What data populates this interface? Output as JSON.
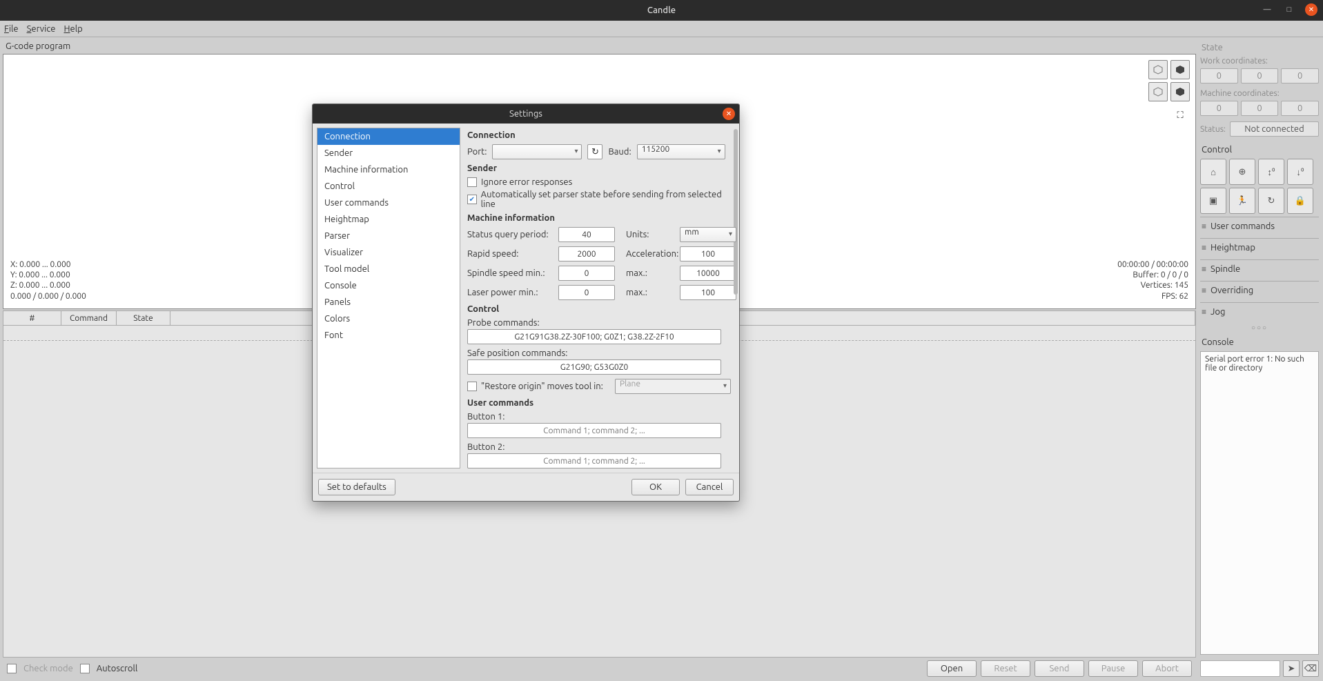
{
  "os": {
    "title": "Candle",
    "minimize": "—",
    "maximize": "□",
    "close": "✕"
  },
  "menu": {
    "file": "File",
    "service": "Service",
    "help": "Help"
  },
  "main": {
    "gcode_label": "G-code program",
    "viz": {
      "left_overlay": "X: 0.000 ... 0.000\nY: 0.000 ... 0.000\nZ: 0.000 ... 0.000\n0.000 / 0.000 / 0.000",
      "right_overlay": "00:00:00 / 00:00:00\nBuffer: 0 / 0 / 0\nVertices: 145\nFPS: 62"
    },
    "table": {
      "col_idx": "#",
      "col_cmd": "Command",
      "col_state": "State",
      "col_resp": ""
    },
    "bottom": {
      "check_mode": "Check mode",
      "autoscroll": "Autoscroll",
      "open": "Open",
      "reset": "Reset",
      "send": "Send",
      "pause": "Pause",
      "abort": "Abort"
    }
  },
  "side": {
    "state": "State",
    "work_coords": "Work coordinates:",
    "machine_coords": "Machine coordinates:",
    "zero": "0",
    "status_label": "Status:",
    "status_value": "Not connected",
    "control": "Control",
    "acc_user": "User commands",
    "acc_height": "Heightmap",
    "acc_spindle": "Spindle",
    "acc_over": "Overriding",
    "acc_jog": "Jog",
    "grip": "○○○",
    "console": "Console",
    "console_text": "Serial port error 1: No such file or directory"
  },
  "dlg": {
    "title": "Settings",
    "sidebar": [
      "Connection",
      "Sender",
      "Machine information",
      "Control",
      "User commands",
      "Heightmap",
      "Parser",
      "Visualizer",
      "Tool model",
      "Console",
      "Panels",
      "Colors",
      "Font"
    ],
    "s_connection": "Connection",
    "port": "Port:",
    "baud": "Baud:",
    "baud_val": "115200",
    "refresh_glyph": "↻",
    "s_sender": "Sender",
    "ignore_err": "Ignore error responses",
    "auto_parser": "Automatically set parser state before sending from selected line",
    "s_machine": "Machine information",
    "status_query": "Status query period:",
    "status_query_val": "40",
    "units": "Units:",
    "units_val": "mm",
    "rapid": "Rapid speed:",
    "rapid_val": "2000",
    "accel": "Acceleration:",
    "accel_val": "100",
    "spindle_min": "Spindle speed min.:",
    "spindle_min_val": "0",
    "max": "max.:",
    "spindle_max_val": "10000",
    "laser_min": "Laser power min.:",
    "laser_min_val": "0",
    "laser_max_val": "100",
    "s_control": "Control",
    "probe_cmds": "Probe commands:",
    "probe_val": "G21G91G38.2Z-30F100; G0Z1; G38.2Z-2F10",
    "safe_cmds": "Safe position commands:",
    "safe_val": "G21G90; G53G0Z0",
    "restore": "\"Restore origin\" moves tool in:",
    "plane": "Plane",
    "s_user": "User commands",
    "btn1": "Button 1:",
    "btn2": "Button 2:",
    "user_placeholder": "Command 1; command 2; ...",
    "defaults": "Set to defaults",
    "ok": "OK",
    "cancel": "Cancel"
  }
}
